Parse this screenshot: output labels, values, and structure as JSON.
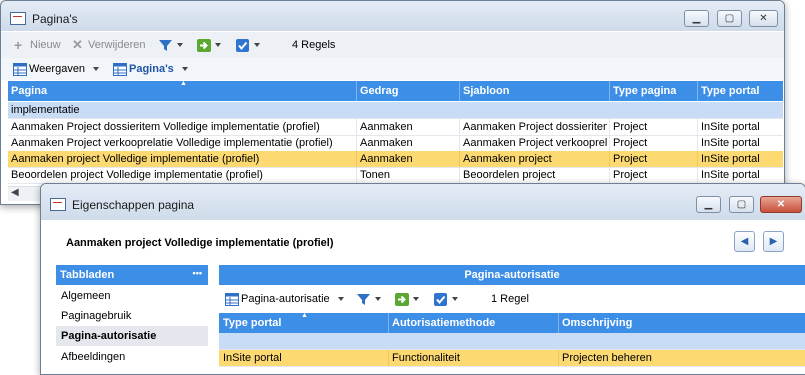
{
  "window1": {
    "title": "Pagina's",
    "toolbar": {
      "new_label": "Nieuw",
      "delete_label": "Verwijderen",
      "record_count": "4 Regels"
    },
    "views": {
      "views_label": "Weergaven",
      "current_view": "Pagina's"
    },
    "columns": [
      "Pagina",
      "Gedrag",
      "Sjabloon",
      "Type pagina",
      "Type portal"
    ],
    "group_label": "implementatie",
    "rows": [
      [
        "Aanmaken Project dossieritem Volledige implementatie (profiel)",
        "Aanmaken",
        "Aanmaken Project dossieritem",
        "Project",
        "InSite portal"
      ],
      [
        "Aanmaken Project verkooprelatie Volledige implementatie (profiel)",
        "Aanmaken",
        "Aanmaken Project verkooprelatie",
        "Project",
        "InSite portal"
      ],
      [
        "Aanmaken project Volledige implementatie (profiel)",
        "Aanmaken",
        "Aanmaken project",
        "Project",
        "InSite portal"
      ],
      [
        "Beoordelen project Volledige implementatie (profiel)",
        "Tonen",
        "Beoordelen project",
        "Project",
        "InSite portal"
      ]
    ],
    "selected_row": 2
  },
  "window2": {
    "title": "Eigenschappen pagina",
    "heading": "Aanmaken project Volledige implementatie (profiel)",
    "tabs_header": "Tabbladen",
    "tabs_more": "•••",
    "tabs": [
      "Algemeen",
      "Paginagebruik",
      "Pagina-autorisatie",
      "Afbeeldingen"
    ],
    "active_tab": 2,
    "panel_title": "Pagina-autorisatie",
    "panel_view": "Pagina-autorisatie",
    "panel_count": "1 Regel",
    "columns": [
      "Type portal",
      "Autorisatiemethode",
      "Omschrijving"
    ],
    "rows": [
      [
        "InSite portal",
        "Functionaliteit",
        "Projecten beheren"
      ]
    ]
  },
  "colors": {
    "header_blue": "#3d8ee6",
    "selection": "#fdd971",
    "group_row": "#c9dcf6"
  }
}
